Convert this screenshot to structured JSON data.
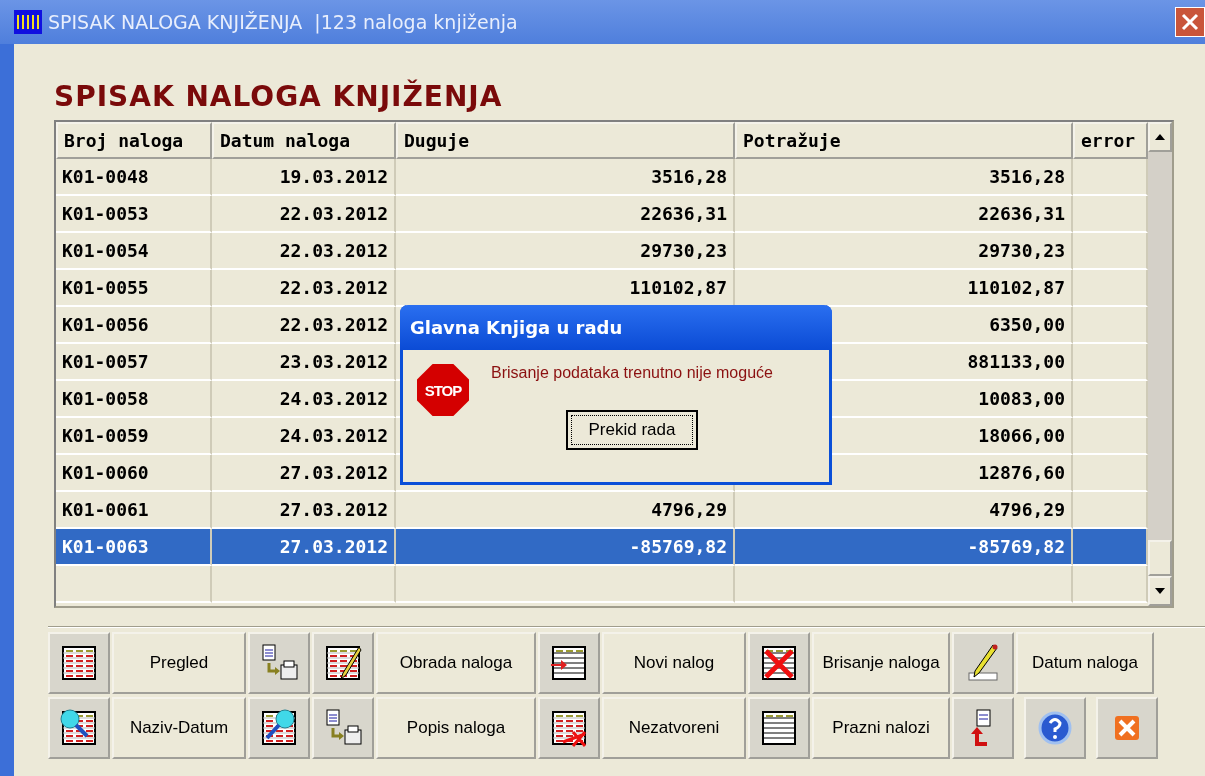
{
  "window": {
    "title": "SPISAK NALOGA KNJIŽENJA  |123 naloga knjiženja"
  },
  "heading": "SPISAK NALOGA KNJIŽENJA",
  "table": {
    "columns": [
      "Broj naloga",
      "Datum naloga",
      "Duguje",
      "Potražuje",
      "error"
    ],
    "rows": [
      {
        "broj": "K01-0048",
        "datum": "19.03.2012",
        "duguje": "3516,28",
        "potrazuje": "3516,28",
        "selected": false
      },
      {
        "broj": "K01-0053",
        "datum": "22.03.2012",
        "duguje": "22636,31",
        "potrazuje": "22636,31",
        "selected": false
      },
      {
        "broj": "K01-0054",
        "datum": "22.03.2012",
        "duguje": "29730,23",
        "potrazuje": "29730,23",
        "selected": false
      },
      {
        "broj": "K01-0055",
        "datum": "22.03.2012",
        "duguje": "110102,87",
        "potrazuje": "110102,87",
        "selected": false
      },
      {
        "broj": "K01-0056",
        "datum": "22.03.2012",
        "potrazuje": "6350,00",
        "selected": false
      },
      {
        "broj": "K01-0057",
        "datum": "23.03.2012",
        "potrazuje": "881133,00",
        "selected": false
      },
      {
        "broj": "K01-0058",
        "datum": "24.03.2012",
        "potrazuje": "10083,00",
        "selected": false
      },
      {
        "broj": "K01-0059",
        "datum": "24.03.2012",
        "potrazuje": "18066,00",
        "selected": false
      },
      {
        "broj": "K01-0060",
        "datum": "27.03.2012",
        "potrazuje": "12876,60",
        "selected": false
      },
      {
        "broj": "K01-0061",
        "datum": "27.03.2012",
        "duguje": "4796,29",
        "potrazuje": "4796,29",
        "selected": false
      },
      {
        "broj": "K01-0063",
        "datum": "27.03.2012",
        "duguje": "-85769,82",
        "potrazuje": "-85769,82",
        "selected": true
      }
    ]
  },
  "toolbar": [
    [
      {
        "kind": "icon"
      },
      {
        "kind": "label",
        "label": "Pregled"
      },
      {
        "kind": "icon"
      },
      {
        "kind": "icon"
      },
      {
        "kind": "label",
        "label": "Obrada naloga"
      },
      {
        "kind": "icon"
      },
      {
        "kind": "label",
        "label": "Novi nalog"
      },
      {
        "kind": "icon"
      },
      {
        "kind": "label",
        "label": "Brisanje naloga"
      },
      {
        "kind": "icon"
      },
      {
        "kind": "label",
        "label": "Datum naloga"
      }
    ],
    [
      {
        "kind": "icon"
      },
      {
        "kind": "label",
        "label": "Naziv-Datum"
      },
      {
        "kind": "icon"
      },
      {
        "kind": "icon"
      },
      {
        "kind": "label",
        "label": "Popis naloga"
      },
      {
        "kind": "icon"
      },
      {
        "kind": "label",
        "label": "Nezatvoreni"
      },
      {
        "kind": "icon"
      },
      {
        "kind": "label",
        "label": "Prazni nalozi"
      },
      {
        "kind": "icon"
      },
      {
        "kind": "icon"
      },
      {
        "kind": "icon"
      }
    ]
  ],
  "dialog": {
    "title": "Glavna Knjiga u radu",
    "icon_text": "STOP",
    "message": "Brisanje podataka trenutno nije moguće",
    "button": "Prekid rada"
  }
}
